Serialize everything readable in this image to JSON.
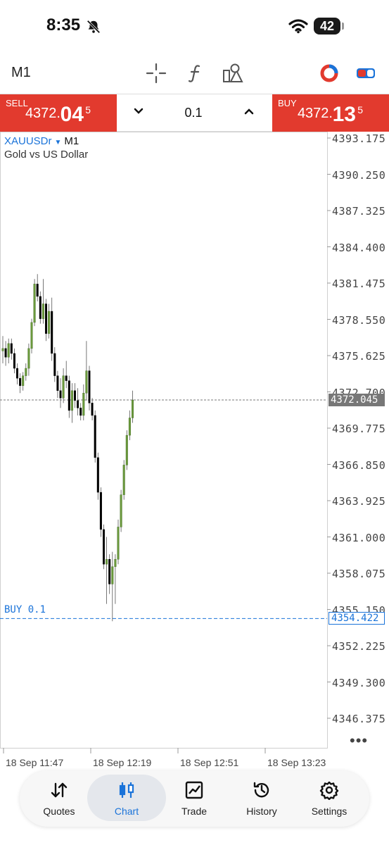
{
  "status_bar": {
    "time": "8:35",
    "battery": "42"
  },
  "toolbar": {
    "timeframe": "M1",
    "icons": [
      "crosshair-icon",
      "function-icon",
      "objects-icon",
      "indicator-icon",
      "toggle-icon"
    ]
  },
  "trade": {
    "sell_label": "SELL",
    "sell_price_main": "4372.",
    "sell_price_big": "04",
    "sell_price_sup": "5",
    "buy_label": "BUY",
    "buy_price_main": "4372.",
    "buy_price_big": "13",
    "buy_price_sup": "5",
    "lot": "0.1"
  },
  "chart": {
    "symbol": "XAUUSDr",
    "timeframe": "M1",
    "description": "Gold vs US Dollar",
    "current_price": "4372.045",
    "order_label": "BUY 0.1",
    "order_price": "4354.422",
    "price_labels": [
      "4393.175",
      "4390.250",
      "4387.325",
      "4384.400",
      "4381.475",
      "4378.550",
      "4375.625",
      "4372.700",
      "4369.775",
      "4366.850",
      "4363.925",
      "4361.000",
      "4358.075",
      "4355.150",
      "4352.225",
      "4349.300",
      "4346.375"
    ],
    "time_labels": [
      "18 Sep 11:47",
      "18 Sep 12:19",
      "18 Sep 12:51",
      "18 Sep 13:23"
    ],
    "up_color": "#6b9a3c",
    "down_color": "#000000"
  },
  "chart_data": {
    "type": "candlestick",
    "symbol": "XAUUSDr",
    "timeframe": "M1",
    "ylim": [
      4344.5,
      4394.0
    ],
    "candles": [
      {
        "o": 4376.0,
        "h": 4377.2,
        "l": 4375.0,
        "c": 4376.2
      },
      {
        "o": 4376.2,
        "h": 4376.8,
        "l": 4374.8,
        "c": 4375.5
      },
      {
        "o": 4375.5,
        "h": 4377.0,
        "l": 4375.0,
        "c": 4376.6
      },
      {
        "o": 4376.6,
        "h": 4377.0,
        "l": 4375.3,
        "c": 4375.8
      },
      {
        "o": 4375.8,
        "h": 4376.2,
        "l": 4374.2,
        "c": 4374.6
      },
      {
        "o": 4374.6,
        "h": 4375.0,
        "l": 4373.3,
        "c": 4373.8
      },
      {
        "o": 4373.8,
        "h": 4374.2,
        "l": 4372.6,
        "c": 4373.2
      },
      {
        "o": 4373.2,
        "h": 4374.3,
        "l": 4372.8,
        "c": 4374.0
      },
      {
        "o": 4374.0,
        "h": 4375.0,
        "l": 4373.6,
        "c": 4374.6
      },
      {
        "o": 4374.6,
        "h": 4376.6,
        "l": 4374.0,
        "c": 4376.2
      },
      {
        "o": 4376.2,
        "h": 4378.6,
        "l": 4375.8,
        "c": 4378.3
      },
      {
        "o": 4378.3,
        "h": 4381.8,
        "l": 4378.0,
        "c": 4381.4
      },
      {
        "o": 4381.4,
        "h": 4382.2,
        "l": 4380.0,
        "c": 4380.4
      },
      {
        "o": 4380.4,
        "h": 4380.8,
        "l": 4378.2,
        "c": 4378.6
      },
      {
        "o": 4378.6,
        "h": 4381.8,
        "l": 4378.2,
        "c": 4379.8
      },
      {
        "o": 4379.8,
        "h": 4380.2,
        "l": 4376.8,
        "c": 4377.4
      },
      {
        "o": 4377.4,
        "h": 4379.8,
        "l": 4377.0,
        "c": 4379.2
      },
      {
        "o": 4379.2,
        "h": 4380.3,
        "l": 4375.2,
        "c": 4375.8
      },
      {
        "o": 4375.8,
        "h": 4376.3,
        "l": 4373.5,
        "c": 4374.0
      },
      {
        "o": 4374.0,
        "h": 4374.4,
        "l": 4372.2,
        "c": 4372.8
      },
      {
        "o": 4372.8,
        "h": 4373.8,
        "l": 4371.4,
        "c": 4372.2
      },
      {
        "o": 4372.2,
        "h": 4374.6,
        "l": 4371.8,
        "c": 4374.0
      },
      {
        "o": 4374.0,
        "h": 4375.2,
        "l": 4373.0,
        "c": 4373.6
      },
      {
        "o": 4373.6,
        "h": 4374.0,
        "l": 4370.6,
        "c": 4371.2
      },
      {
        "o": 4371.2,
        "h": 4373.4,
        "l": 4370.2,
        "c": 4372.8
      },
      {
        "o": 4372.8,
        "h": 4373.4,
        "l": 4371.4,
        "c": 4372.0
      },
      {
        "o": 4372.0,
        "h": 4373.0,
        "l": 4370.8,
        "c": 4371.4
      },
      {
        "o": 4371.4,
        "h": 4371.8,
        "l": 4370.4,
        "c": 4370.8
      },
      {
        "o": 4370.8,
        "h": 4373.3,
        "l": 4370.4,
        "c": 4372.6
      },
      {
        "o": 4372.6,
        "h": 4376.8,
        "l": 4372.0,
        "c": 4374.4
      },
      {
        "o": 4374.4,
        "h": 4374.8,
        "l": 4371.2,
        "c": 4371.8
      },
      {
        "o": 4371.8,
        "h": 4372.2,
        "l": 4370.4,
        "c": 4370.8
      },
      {
        "o": 4370.8,
        "h": 4371.2,
        "l": 4367.0,
        "c": 4367.4
      },
      {
        "o": 4367.4,
        "h": 4367.8,
        "l": 4364.0,
        "c": 4364.6
      },
      {
        "o": 4364.6,
        "h": 4365.0,
        "l": 4361.0,
        "c": 4361.6
      },
      {
        "o": 4361.6,
        "h": 4362.0,
        "l": 4358.4,
        "c": 4358.8
      },
      {
        "o": 4358.8,
        "h": 4361.0,
        "l": 4355.6,
        "c": 4359.2
      },
      {
        "o": 4359.2,
        "h": 4359.6,
        "l": 4356.4,
        "c": 4357.2
      },
      {
        "o": 4357.2,
        "h": 4359.8,
        "l": 4354.2,
        "c": 4358.6
      },
      {
        "o": 4358.6,
        "h": 4359.6,
        "l": 4355.6,
        "c": 4359.2
      },
      {
        "o": 4359.2,
        "h": 4362.4,
        "l": 4358.8,
        "c": 4361.8
      },
      {
        "o": 4361.8,
        "h": 4364.8,
        "l": 4361.4,
        "c": 4364.4
      },
      {
        "o": 4364.4,
        "h": 4367.2,
        "l": 4364.0,
        "c": 4366.8
      },
      {
        "o": 4366.8,
        "h": 4369.6,
        "l": 4366.4,
        "c": 4369.2
      },
      {
        "o": 4369.2,
        "h": 4371.2,
        "l": 4368.8,
        "c": 4370.6
      },
      {
        "o": 4370.6,
        "h": 4372.8,
        "l": 4370.2,
        "c": 4372.045
      }
    ],
    "current_price": 4372.045,
    "order_line": 4354.422,
    "x_tick_labels": [
      "18 Sep 11:47",
      "18 Sep 12:19",
      "18 Sep 12:51",
      "18 Sep 13:23"
    ]
  },
  "tabs": [
    {
      "label": "Quotes",
      "icon": "quotes-icon"
    },
    {
      "label": "Chart",
      "icon": "chart-icon",
      "active": true
    },
    {
      "label": "Trade",
      "icon": "trade-icon"
    },
    {
      "label": "History",
      "icon": "history-icon"
    },
    {
      "label": "Settings",
      "icon": "settings-icon"
    }
  ]
}
